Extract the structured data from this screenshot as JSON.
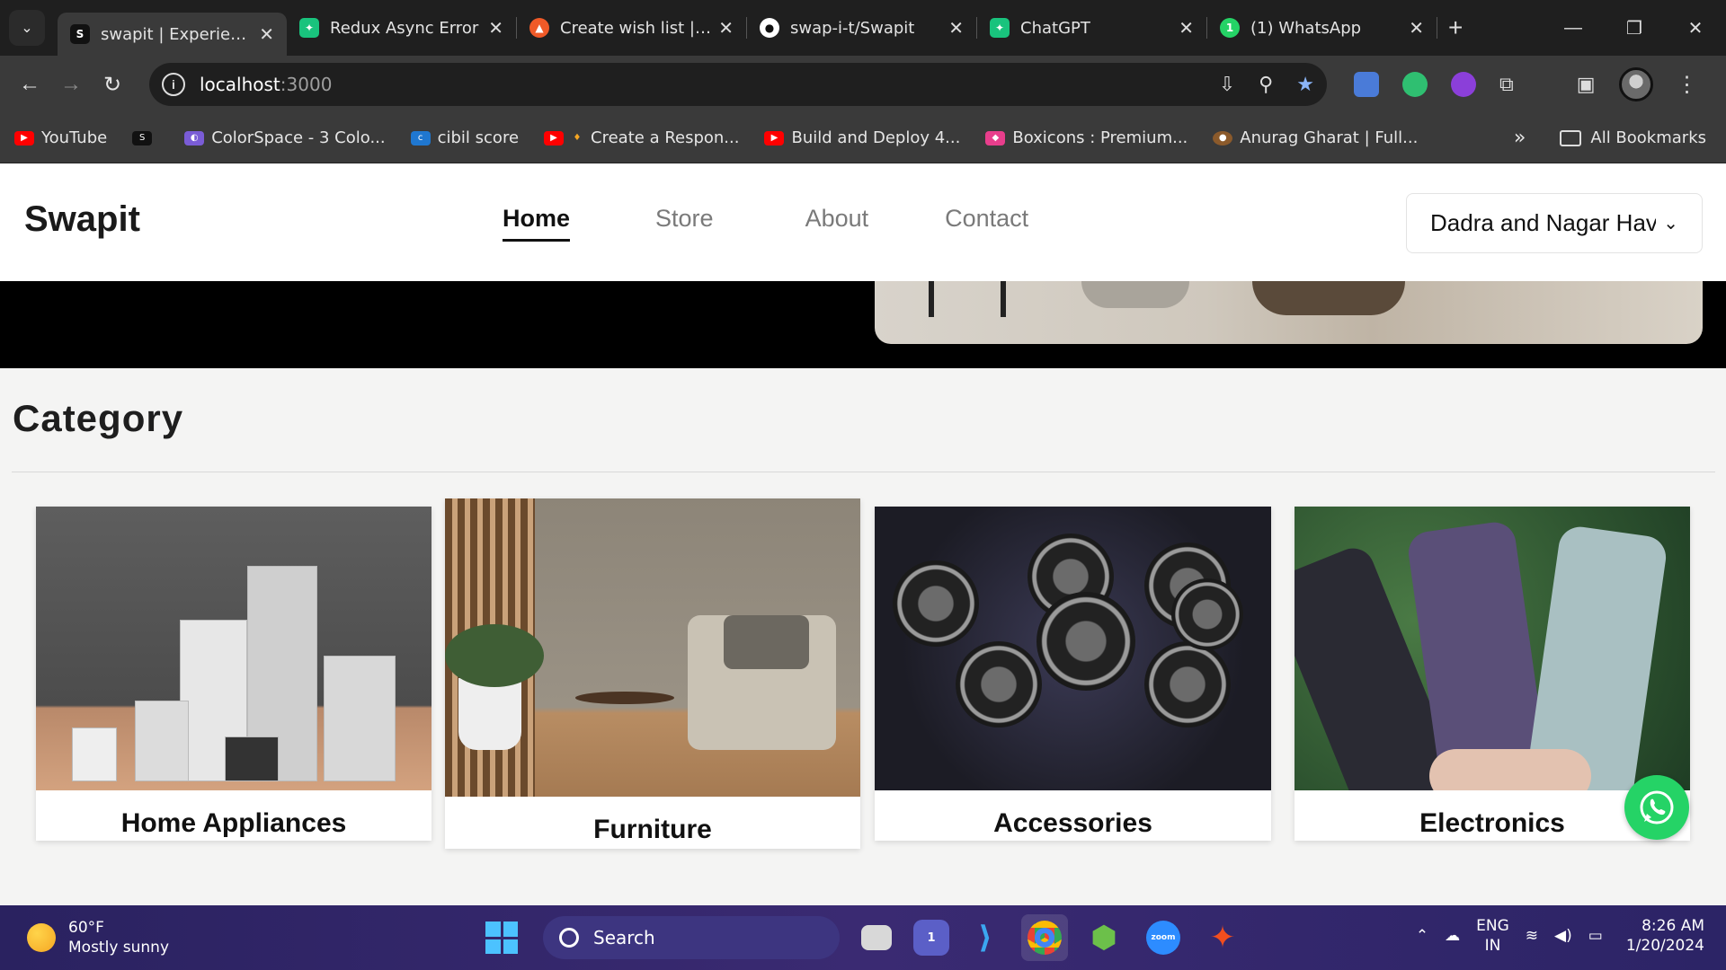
{
  "browser": {
    "tabs": [
      {
        "title": "swapit | Experience",
        "active": true,
        "color": "#111111",
        "glyph": "S"
      },
      {
        "title": "Redux Async Error",
        "active": false,
        "color": "#19c37d",
        "glyph": "✦"
      },
      {
        "title": "Create wish list | pu",
        "active": false,
        "color": "#f05a28",
        "glyph": "▲"
      },
      {
        "title": "swap-i-t/Swapit",
        "active": false,
        "color": "#ffffff",
        "glyph": "●"
      },
      {
        "title": "ChatGPT",
        "active": false,
        "color": "#19c37d",
        "glyph": "✦"
      },
      {
        "title": "(1) WhatsApp",
        "active": false,
        "color": "#25d366",
        "glyph": "1"
      }
    ],
    "url_host": "localhost",
    "url_port": ":3000",
    "bookmarks": [
      {
        "label": "YouTube",
        "color": "#ff0000"
      },
      {
        "label": "",
        "color": "#111111"
      },
      {
        "label": "ColorSpace - 3 Colo...",
        "color": "#7a5cd6"
      },
      {
        "label": "cibil score",
        "color": "#1f77d0"
      },
      {
        "label": "Create a Respon...",
        "color": "#ff0000"
      },
      {
        "label": "Build and Deploy 4...",
        "color": "#ff0000"
      },
      {
        "label": "Boxicons : Premium...",
        "color": "#e83e8c"
      },
      {
        "label": "Anurag Gharat | Full...",
        "color": "#8b5a2b"
      }
    ],
    "all_bookmarks": "All Bookmarks"
  },
  "site": {
    "logo": "Swapit",
    "nav": {
      "home": "Home",
      "store": "Store",
      "about": "About",
      "contact": "Contact"
    },
    "region": "Dadra and Nagar Haveli",
    "category_title": "Category",
    "categories": [
      {
        "label": "Home Appliances"
      },
      {
        "label": "Furniture"
      },
      {
        "label": "Accessories"
      },
      {
        "label": "Electronics"
      }
    ]
  },
  "taskbar": {
    "temp": "60°F",
    "weather": "Mostly sunny",
    "search": "Search",
    "lang1": "ENG",
    "lang2": "IN",
    "time": "8:26 AM",
    "date": "1/20/2024",
    "teams_badge": "1"
  }
}
